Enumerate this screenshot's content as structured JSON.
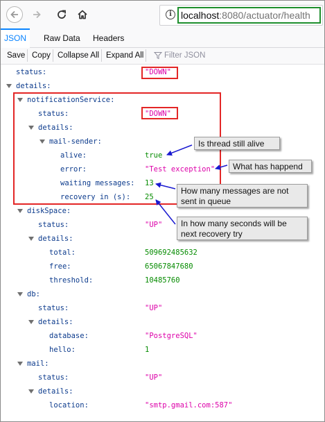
{
  "browser": {
    "url_host": "localhost",
    "url_rest": ":8080/actuator/health"
  },
  "viewer": {
    "tabs": [
      "JSON",
      "Raw Data",
      "Headers"
    ],
    "toolbar": {
      "save": "Save",
      "copy": "Copy",
      "collapse_all": "Collapse All",
      "expand_all": "Expand All",
      "filter_placeholder": "Filter JSON"
    }
  },
  "tree": [
    {
      "key": "status:",
      "value": "\"DOWN\"",
      "type": "str"
    },
    {
      "key": "details:"
    },
    {
      "key": "notificationService:"
    },
    {
      "key": "status:",
      "value": "\"DOWN\"",
      "type": "str"
    },
    {
      "key": "details:"
    },
    {
      "key": "mail-sender:"
    },
    {
      "key": "alive:",
      "value": "true",
      "type": "bool"
    },
    {
      "key": "error:",
      "value": "\"Test exception\"",
      "type": "str"
    },
    {
      "key": "waiting messages:",
      "value": "13",
      "type": "num"
    },
    {
      "key": "recovery in (s):",
      "value": "25",
      "type": "num"
    },
    {
      "key": "diskSpace:"
    },
    {
      "key": "status:",
      "value": "\"UP\"",
      "type": "str"
    },
    {
      "key": "details:"
    },
    {
      "key": "total:",
      "value": "509692485632",
      "type": "num"
    },
    {
      "key": "free:",
      "value": "65067847680",
      "type": "num"
    },
    {
      "key": "threshold:",
      "value": "10485760",
      "type": "num"
    },
    {
      "key": "db:"
    },
    {
      "key": "status:",
      "value": "\"UP\"",
      "type": "str"
    },
    {
      "key": "details:"
    },
    {
      "key": "database:",
      "value": "\"PostgreSQL\"",
      "type": "str"
    },
    {
      "key": "hello:",
      "value": "1",
      "type": "num"
    },
    {
      "key": "mail:"
    },
    {
      "key": "status:",
      "value": "\"UP\"",
      "type": "str"
    },
    {
      "key": "details:"
    },
    {
      "key": "location:",
      "value": "\"smtp.gmail.com:587\"",
      "type": "str"
    }
  ],
  "annotations": {
    "thread_alive": "Is thread still alive",
    "what_happened": "What has happend",
    "messages_not_sent": "How many messages are not sent in queue",
    "recovery_seconds": "In how many seconds will be next recovery try"
  },
  "colors": {
    "key": "#0b3a8c",
    "string": "#dd00a9",
    "number": "#058b00",
    "highlight_red": "#e32626",
    "url_highlight_green": "#1e8f2d",
    "arrow_blue": "#1a1ad0",
    "active_tab": "#0a84ff"
  }
}
